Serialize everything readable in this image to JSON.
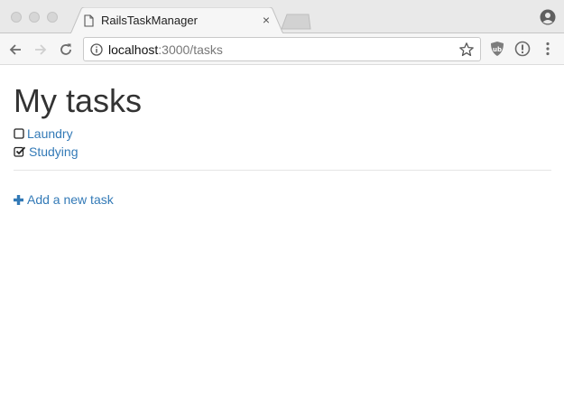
{
  "browser": {
    "tab_title": "RailsTaskManager",
    "tab_close_glyph": "×",
    "url_host": "localhost",
    "url_path": ":3000/tasks",
    "icons": [
      "page-icon",
      "close-icon",
      "new-tab-icon",
      "profile-icon",
      "back-icon",
      "forward-icon",
      "reload-icon",
      "info-icon",
      "star-icon",
      "ublock-icon",
      "extension-icon",
      "menu-icon"
    ]
  },
  "page": {
    "title": "My tasks",
    "tasks": [
      {
        "label": "Laundry",
        "done": false
      },
      {
        "label": "Studying",
        "done": true
      }
    ],
    "add_task_label": "Add a new task",
    "link_color": "#337ab7",
    "text_color": "#333333"
  }
}
